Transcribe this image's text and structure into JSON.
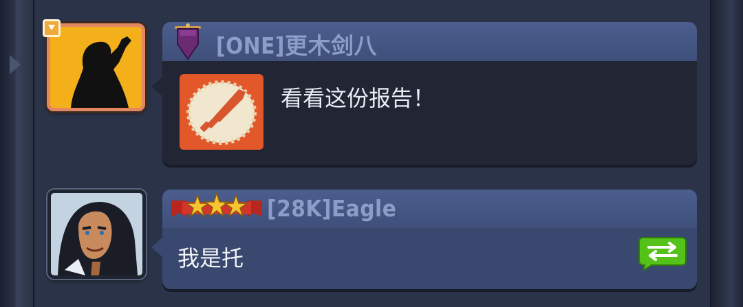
{
  "chat": {
    "messages": [
      {
        "sender": "[ONE]更木剑八",
        "rank_icon": "purple-pennant-icon",
        "avatar": "shadow-silhouette-avatar",
        "attachment_icon": "sword-report-icon",
        "text": "看看这份报告！"
      },
      {
        "sender": "[28K]Eagle",
        "rank_icon": "three-star-banner-icon",
        "avatar": "hero-portrait-avatar",
        "text": "我是托",
        "action_icon": "translate-arrows-icon"
      }
    ]
  },
  "colors": {
    "panel": "#2b3348",
    "bubble_dark": "#222634",
    "bubble_blue": "#39486e",
    "header": "#4c5e8e",
    "name_text": "#8e9dc7",
    "gold_frame": "#f3b01b",
    "report_orange": "#e2582b",
    "translate_green": "#55c21a"
  }
}
